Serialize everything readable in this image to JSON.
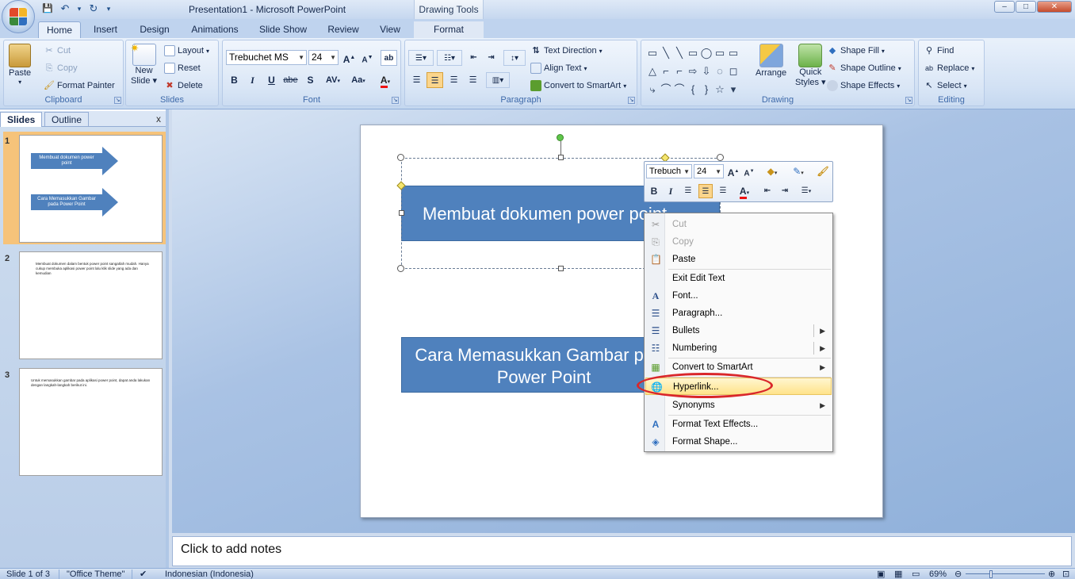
{
  "window": {
    "title": "Presentation1 - Microsoft PowerPoint",
    "contextual_tab_group": "Drawing Tools",
    "minimize": "–",
    "maximize": "□",
    "close": "✕"
  },
  "qat": {
    "save": "💾",
    "undo": "↶",
    "undo_dd": "▾",
    "redo": "↻",
    "more": "▾"
  },
  "ribbon_tabs": [
    "Home",
    "Insert",
    "Design",
    "Animations",
    "Slide Show",
    "Review",
    "View",
    "Format"
  ],
  "clipboard": {
    "paste": "Paste",
    "cut": "Cut",
    "copy": "Copy",
    "format_painter": "Format Painter",
    "label": "Clipboard"
  },
  "slides_group": {
    "new_slide": "New",
    "new_slide2": "Slide",
    "layout": "Layout",
    "reset": "Reset",
    "delete": "Delete",
    "label": "Slides"
  },
  "font_group": {
    "font_name": "Trebuchet MS",
    "font_size": "24",
    "bold": "B",
    "italic": "I",
    "underline": "U",
    "strike": "abe",
    "shadow": "S",
    "spacing": "AV",
    "case": "Aa",
    "color": "A",
    "label": "Font"
  },
  "paragraph_group": {
    "text_direction": "Text Direction",
    "align_text": "Align Text",
    "convert_smartart": "Convert to SmartArt",
    "label": "Paragraph"
  },
  "drawing_group": {
    "arrange": "Arrange",
    "quick_styles": "Quick",
    "quick_styles2": "Styles",
    "shape_fill": "Shape Fill",
    "shape_outline": "Shape Outline",
    "shape_effects": "Shape Effects",
    "label": "Drawing",
    "shape_glyphs": [
      "▭",
      "╲",
      "╲",
      "▭",
      "◯",
      "▭",
      "▭",
      "△",
      "⌐",
      "⌐",
      "⇨",
      "⇩",
      "◌",
      "◻",
      "⤷",
      "⌒",
      "⌒",
      "{",
      "}",
      "☆",
      "▾"
    ]
  },
  "editing_group": {
    "find": "Find",
    "replace": "Replace",
    "select": "Select",
    "label": "Editing"
  },
  "pane": {
    "tab_slides": "Slides",
    "tab_outline": "Outline",
    "close": "x",
    "thumbs": [
      {
        "num": "1",
        "arrow1": "Membuat dokumen power point",
        "arrow2": "Cara Memasukkan Gambar pada Power Point"
      },
      {
        "num": "2",
        "text": "Membuat dokumen dalam bentuk power point sangatlah mudah. Hanya cukup membuka aplikasi power point lalu klik slide yang ada dan kemudian"
      },
      {
        "num": "3",
        "text": "Untuk memasukkan gambar pada aplikasi power point, dapat anda lakukan dengan langkah-langkah berikut ini."
      }
    ]
  },
  "slide": {
    "shape1_text": "Membuat dokumen power point",
    "shape2_line1": "Cara Memasukkan Gambar pada",
    "shape2_line2": "Power Point"
  },
  "mini_toolbar": {
    "font": "Trebuch",
    "size": "24",
    "bold": "B",
    "italic": "I",
    "color": "A"
  },
  "context_menu": {
    "items": [
      {
        "label": "Cut",
        "icon": "scissors-icon",
        "disabled": true
      },
      {
        "label": "Copy",
        "icon": "copy-icon",
        "disabled": true
      },
      {
        "label": "Paste",
        "icon": "paste-icon"
      },
      {
        "label": "Exit Edit Text"
      },
      {
        "label": "Font...",
        "icon": "font-icon"
      },
      {
        "label": "Paragraph...",
        "icon": "paragraph-icon"
      },
      {
        "label": "Bullets",
        "icon": "bullets-icon",
        "submenu": true
      },
      {
        "label": "Numbering",
        "icon": "numbering-icon",
        "submenu": true
      },
      {
        "label": "Convert to SmartArt",
        "icon": "smartart-icon",
        "submenu": true
      },
      {
        "label": "Hyperlink...",
        "icon": "hyperlink-icon",
        "highlighted": true
      },
      {
        "label": "Synonyms",
        "submenu": true
      },
      {
        "label": "Format Text Effects...",
        "icon": "text-effects-icon"
      },
      {
        "label": "Format Shape...",
        "icon": "format-shape-icon"
      }
    ]
  },
  "notes": {
    "placeholder": "Click to add notes"
  },
  "statusbar": {
    "slide": "Slide 1 of 3",
    "theme": "\"Office Theme\"",
    "language": "Indonesian (Indonesia)",
    "zoom": "69%"
  },
  "colors": {
    "shape_fill": "#4f81bd",
    "highlight_ring": "#d9262a",
    "accent": "#15428b"
  }
}
